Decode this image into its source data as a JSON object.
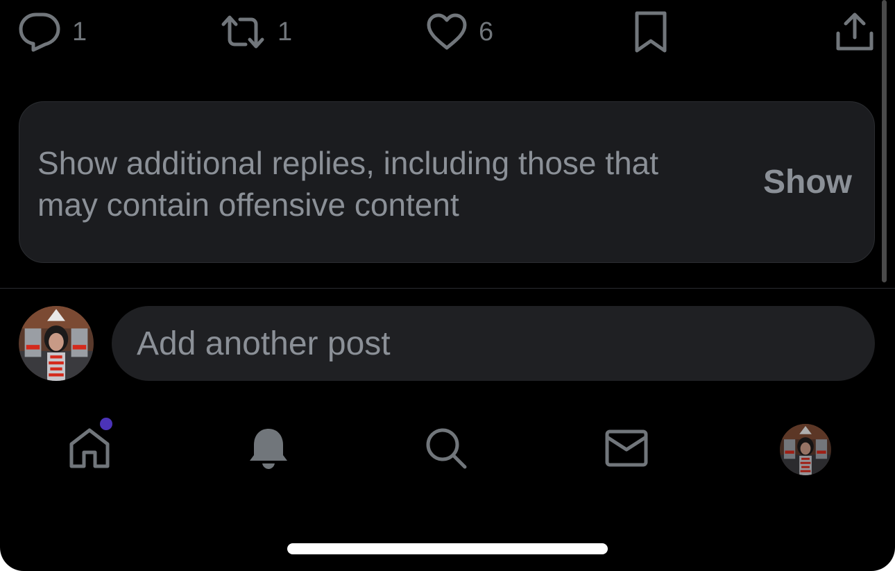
{
  "colors": {
    "background": "#000000",
    "icon": "#71767b",
    "text_secondary": "#8b9097",
    "card_background": "#1b1c1f",
    "input_background": "#1f2023",
    "notification_dot": "#4b33b8",
    "home_indicator": "#ffffff"
  },
  "actions": {
    "reply": {
      "icon": "reply-icon",
      "count": "1"
    },
    "repost": {
      "icon": "repost-icon",
      "count": "1"
    },
    "like": {
      "icon": "heart-icon",
      "count": "6"
    },
    "bookmark": {
      "icon": "bookmark-icon"
    },
    "share": {
      "icon": "share-icon"
    }
  },
  "notice": {
    "message": "Show additional replies, including those that may contain offensive content",
    "button_label": "Show"
  },
  "composer": {
    "placeholder": "Add another post"
  },
  "tab_bar": {
    "items": [
      {
        "name": "home",
        "icon": "home-icon",
        "has_badge": true
      },
      {
        "name": "notifications",
        "icon": "bell-icon"
      },
      {
        "name": "search",
        "icon": "search-icon"
      },
      {
        "name": "messages",
        "icon": "envelope-icon"
      },
      {
        "name": "profile",
        "icon": "avatar"
      }
    ]
  }
}
